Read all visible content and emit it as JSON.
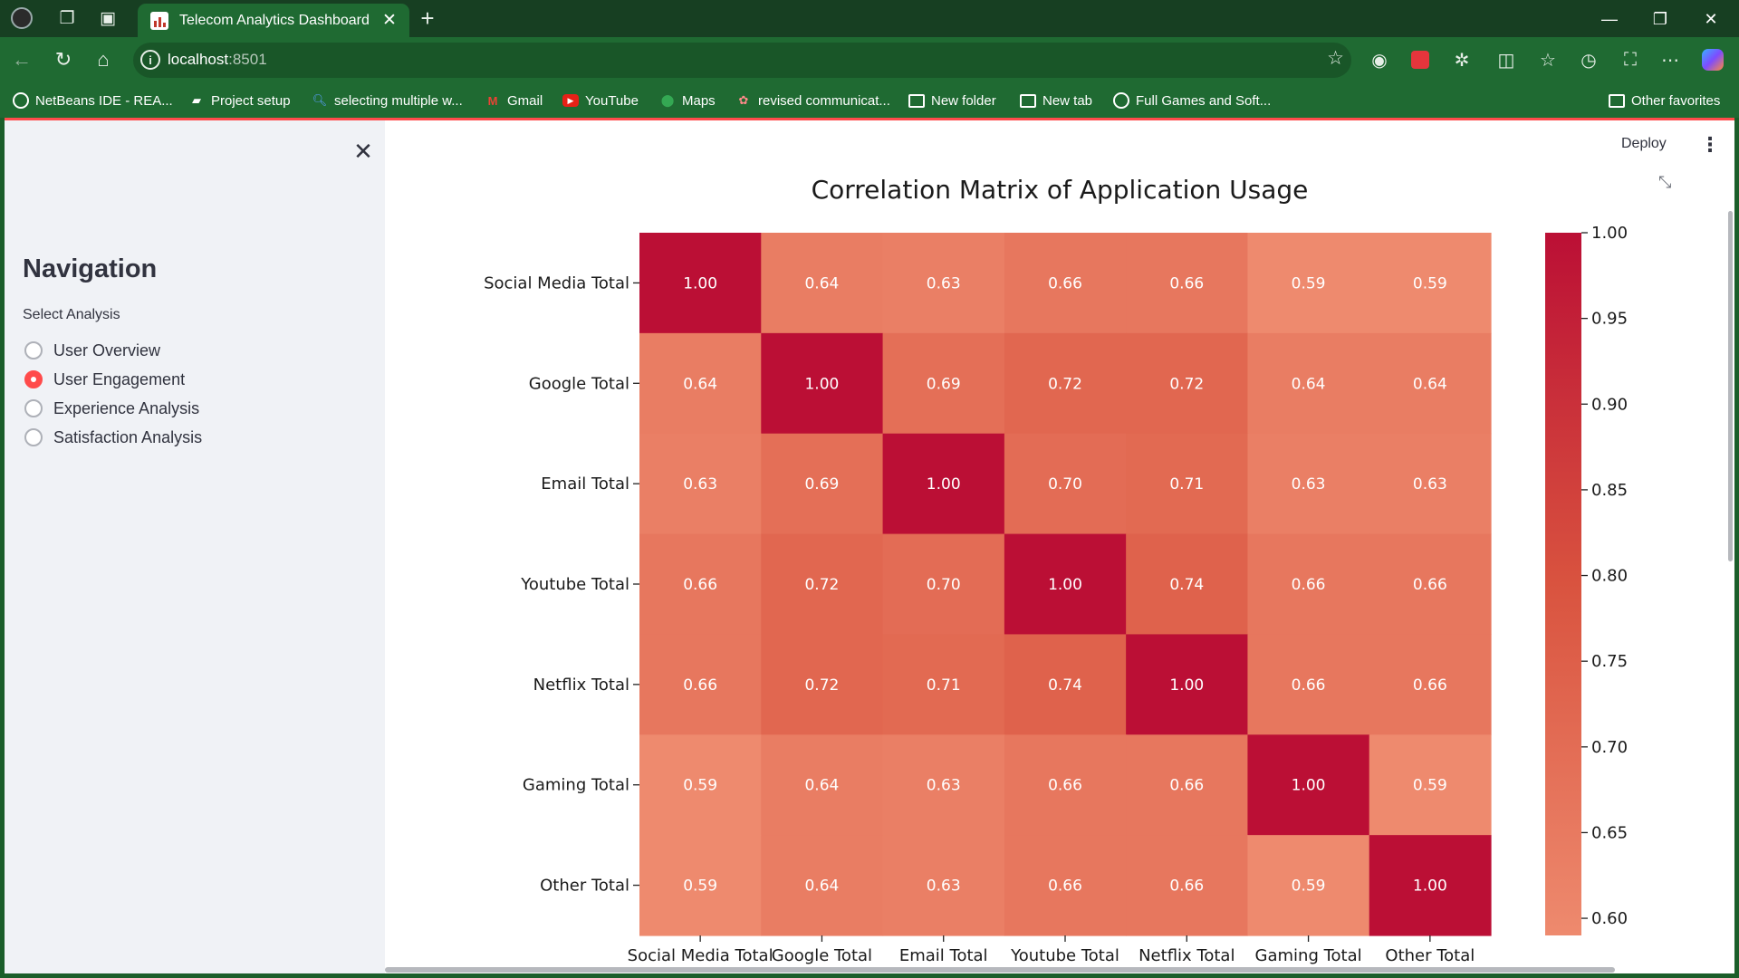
{
  "browser": {
    "tab_title": "Telecom Analytics Dashboard",
    "url_host": "localhost",
    "url_port": ":8501",
    "bookmarks": [
      {
        "label": "NetBeans IDE - REA...",
        "icon": "globe-icon"
      },
      {
        "label": "Project setup",
        "icon": "project-icon"
      },
      {
        "label": "selecting multiple w...",
        "icon": "search-icon"
      },
      {
        "label": "Gmail",
        "icon": "gmail-icon"
      },
      {
        "label": "YouTube",
        "icon": "youtube-icon"
      },
      {
        "label": "Maps",
        "icon": "maps-icon"
      },
      {
        "label": "revised communicat...",
        "icon": "doc-icon"
      },
      {
        "label": "New folder",
        "icon": "folder-icon"
      },
      {
        "label": "New tab",
        "icon": "newtab-icon"
      },
      {
        "label": "Full Games and Soft...",
        "icon": "globe-icon"
      }
    ],
    "other_favorites": "Other favorites"
  },
  "app": {
    "deploy_label": "Deploy",
    "accent_color": "#ff4b4b"
  },
  "sidebar": {
    "title": "Navigation",
    "select_label": "Select Analysis",
    "options": [
      {
        "label": "User Overview",
        "selected": false
      },
      {
        "label": "User Engagement",
        "selected": true
      },
      {
        "label": "Experience Analysis",
        "selected": false
      },
      {
        "label": "Satisfaction Analysis",
        "selected": false
      }
    ]
  },
  "chart_data": {
    "type": "heatmap",
    "title": "Correlation Matrix of Application Usage",
    "categories": [
      "Social Media Total",
      "Google Total",
      "Email Total",
      "Youtube Total",
      "Netflix Total",
      "Gaming Total",
      "Other Total"
    ],
    "values": [
      [
        1.0,
        0.64,
        0.63,
        0.66,
        0.66,
        0.59,
        0.59
      ],
      [
        0.64,
        1.0,
        0.69,
        0.72,
        0.72,
        0.64,
        0.64
      ],
      [
        0.63,
        0.69,
        1.0,
        0.7,
        0.71,
        0.63,
        0.63
      ],
      [
        0.66,
        0.72,
        0.7,
        1.0,
        0.74,
        0.66,
        0.66
      ],
      [
        0.66,
        0.72,
        0.71,
        0.74,
        1.0,
        0.66,
        0.66
      ],
      [
        0.59,
        0.64,
        0.63,
        0.66,
        0.66,
        1.0,
        0.59
      ],
      [
        0.59,
        0.64,
        0.63,
        0.66,
        0.66,
        0.59,
        1.0
      ]
    ],
    "value_format": "0.00",
    "colorbar": {
      "range": [
        0.59,
        1.0
      ],
      "ticks": [
        "0.60",
        "0.65",
        "0.70",
        "0.75",
        "0.80",
        "0.85",
        "0.90",
        "0.95",
        "1.00"
      ],
      "color_low": "#ee8a6e",
      "color_mid": "#d9533f",
      "color_high": "#bb0f35"
    }
  }
}
